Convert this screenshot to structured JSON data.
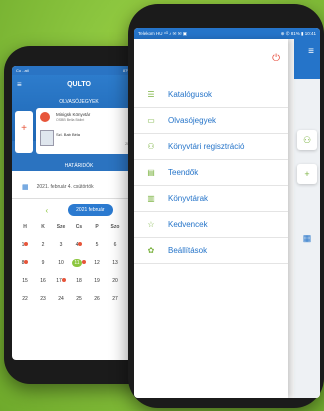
{
  "back_app": {
    "title": "QULTO",
    "status_left": "Co ..atl",
    "status_right": "87% 10:13",
    "subtitle": "OLVASÓJEGYEK",
    "card1_line1": "Minigsk Könyvtár",
    "card1_line2": "OSBB Bella Bálint",
    "card2_line1": "Szl. Bab Béla",
    "card2_date": "2023-10-06",
    "register_text": "Könyvtári regisztráció",
    "deadlines": "HATÁRIDŐK",
    "date_text": "2021. február 4. csütörtök",
    "month_pill": "2021 február",
    "weekdays": [
      "H",
      "K",
      "Sze",
      "Cs",
      "P",
      "Szo",
      "V"
    ],
    "days": [
      "1",
      "2",
      "3",
      "4",
      "5",
      "6",
      "7",
      "8",
      "9",
      "10",
      "11",
      "12",
      "13",
      "14",
      "15",
      "16",
      "17",
      "18",
      "19",
      "20",
      "21",
      "22",
      "23",
      "24",
      "25",
      "26",
      "27",
      "28"
    ]
  },
  "front_app": {
    "status_left": "Telekom HU ⁴ᴳ ♪ ✉ ✉ ▣",
    "status_right": "⊕ ✆ 81% ▮ 10:41",
    "menu_items": [
      {
        "label": "Katalógusok",
        "icon": "list-icon"
      },
      {
        "label": "Olvasójegyek",
        "icon": "card-icon"
      },
      {
        "label": "Könyvtári regisztráció",
        "icon": "user-add-icon"
      },
      {
        "label": "Teendők",
        "icon": "chat-icon"
      },
      {
        "label": "Könyvtárak",
        "icon": "library-icon"
      },
      {
        "label": "Kedvencek",
        "icon": "star-icon"
      },
      {
        "label": "Beállítások",
        "icon": "gear-icon"
      }
    ]
  },
  "colors": {
    "accent": "#2574c9",
    "icon": "#7cb342",
    "power": "#e74c3c",
    "bg": "#8cc63f"
  }
}
